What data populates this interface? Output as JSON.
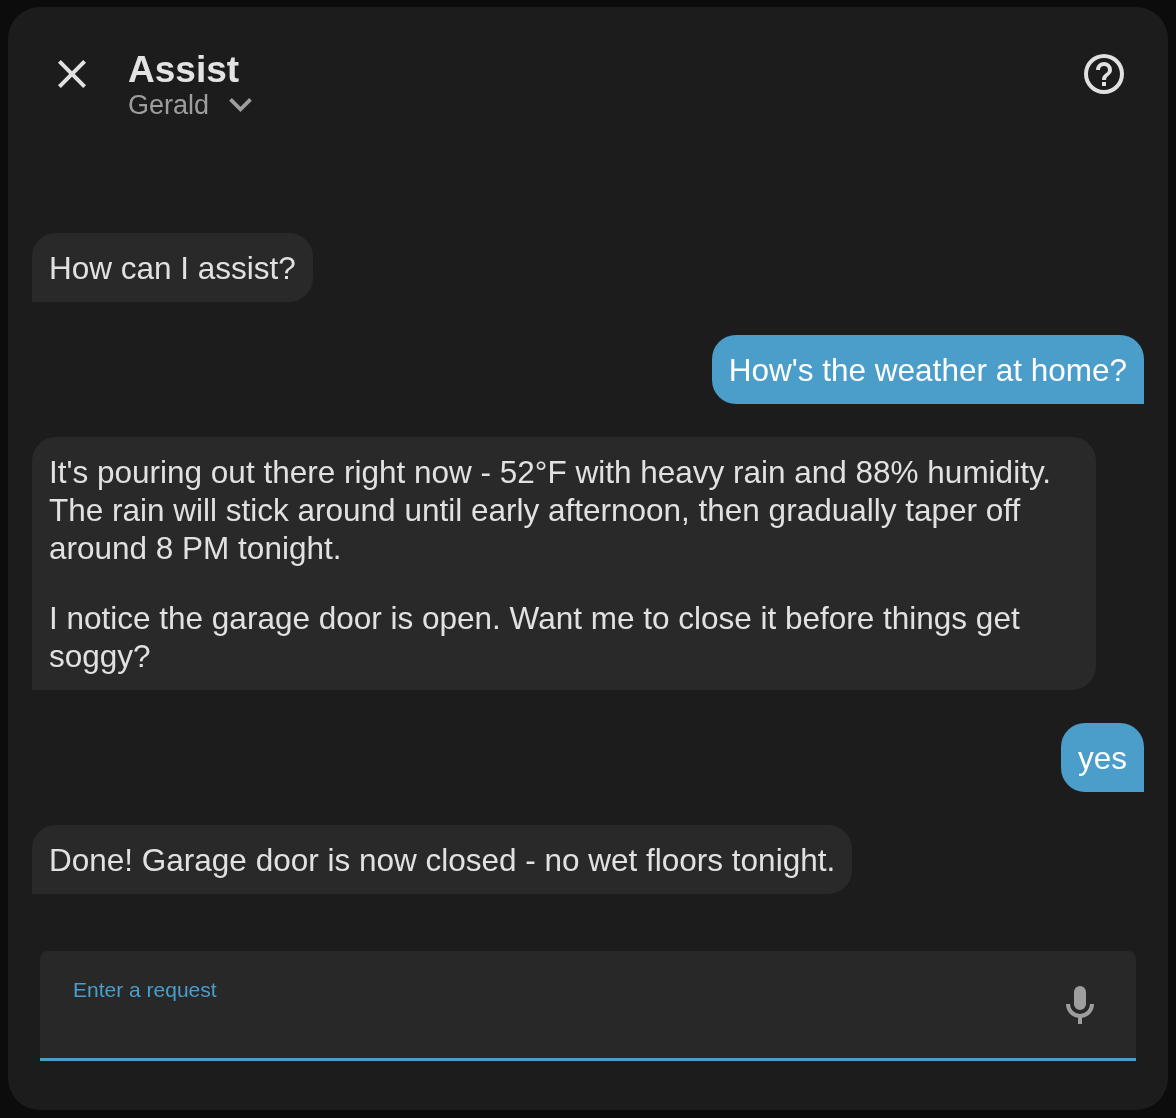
{
  "header": {
    "title": "Assist",
    "assistant_name": "Gerald"
  },
  "messages": [
    {
      "kind": "assistant",
      "paragraphs": [
        "How can I assist?"
      ]
    },
    {
      "kind": "user",
      "paragraphs": [
        "How's the weather at home?"
      ]
    },
    {
      "kind": "assistant",
      "paragraphs": [
        "It's pouring out there right now - 52°F with heavy rain and 88% humidity. The rain will stick around until early afternoon, then gradually taper off around 8 PM tonight.",
        "I notice the garage door is open. Want me to close it before things get soggy?"
      ]
    },
    {
      "kind": "user",
      "paragraphs": [
        "yes"
      ]
    },
    {
      "kind": "assistant",
      "paragraphs": [
        "Done! Garage door is now closed - no wet floors tonight."
      ]
    }
  ],
  "input": {
    "label": "Enter a request",
    "focused": true
  }
}
